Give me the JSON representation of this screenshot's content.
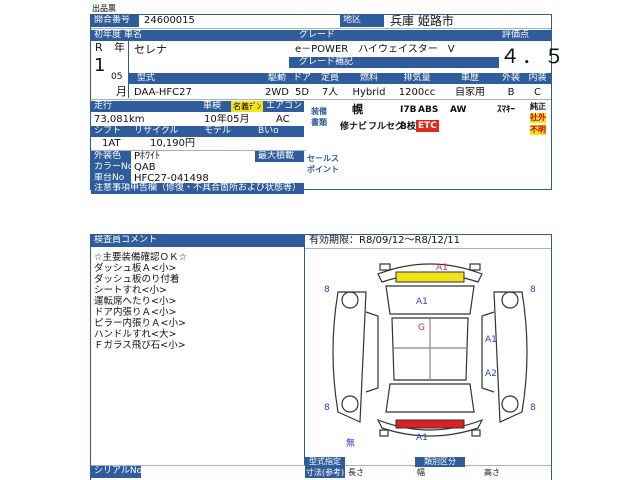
{
  "document_title": "出品票",
  "auction_no": {
    "label": "開合番号",
    "value": "24600015"
  },
  "region": {
    "label": "地区",
    "value": "兵庫 姫路市"
  },
  "first_reg": {
    "label": "初年度",
    "era": "R",
    "year": "1",
    "year_label": "年",
    "month": "05",
    "month_label": "月"
  },
  "car_name": {
    "label": "車名",
    "value": "セレナ"
  },
  "grade": {
    "label": "グレード",
    "value": "e－POWER　ハイウェイスター　V"
  },
  "grade_supplement": {
    "label": "グレード補記",
    "value": ""
  },
  "score": {
    "label": "評価点",
    "value": "４．５"
  },
  "model": {
    "label": "型式",
    "value": "DAA-HFC27"
  },
  "drive": {
    "label": "駆動",
    "value": "2WD"
  },
  "doors": {
    "label": "ドア",
    "value": "5D"
  },
  "seats": {
    "label": "定員",
    "value": "7人"
  },
  "fuel": {
    "label": "燃料",
    "value": "Hybrid"
  },
  "displacement": {
    "label": "排気量",
    "value": "1200cc"
  },
  "usage": {
    "label": "車歴",
    "value": "自家用"
  },
  "exterior": {
    "label": "外装",
    "value": "B"
  },
  "interior": {
    "label": "内装",
    "value": "C"
  },
  "mileage": {
    "label": "走行",
    "value": "73,081km"
  },
  "inspection": {
    "label": "車検",
    "badge": "名義ﾃﾞﾝ",
    "value": "10年05月"
  },
  "aircon": {
    "label": "エアコン",
    "value": "AC"
  },
  "equipment": {
    "label": "装備",
    "label2": "書類"
  },
  "options_row1": [
    "幌",
    "I7B",
    "ABS",
    "AW",
    "ｽﾏｷｰ"
  ],
  "options_row2": [
    "修ナビ",
    "フルセグ",
    "B枝",
    "ETC"
  ],
  "right_flags": [
    "純正",
    "社外",
    "不明"
  ],
  "shift": {
    "label": "シフト",
    "value": "1AT"
  },
  "recycle": {
    "label": "リサイクル",
    "value": "10,190円"
  },
  "model_code": {
    "label": "モデル",
    "value": ""
  },
  "bno": {
    "label": "Bいo",
    "value": ""
  },
  "max_load": {
    "label": "最大積載",
    "value": ""
  },
  "sales_point": {
    "label": "セールス",
    "label2": "ポイント"
  },
  "ext_color": {
    "label": "外装色",
    "value": "Pﾎﾜｲﾄ"
  },
  "color_no": {
    "label": "カラーNo",
    "value": "QAB"
  },
  "chassis_no": {
    "label": "車台No",
    "value": "HFC27-041498"
  },
  "notes": {
    "label": "注意事項申告欄（修復・不具合箇所および状態等）",
    "value": ""
  },
  "inspector_comment": {
    "label": "検査員コメント",
    "lines": [
      "☆主要装備確認ＯＫ☆",
      "ダッシュ板Ａ<小>",
      "ダッシュ板のり付着",
      "シートすれ<小>",
      "運転席へたり<小>",
      "ドア内張りＡ<小>",
      "ピラー内張りＡ<小>",
      "ハンドルすれ<大>",
      "Ｆガラス飛び石<小>"
    ]
  },
  "validity": {
    "label": "有効期限：",
    "value": "R8/09/12～R8/12/11"
  },
  "damage_marks": [
    "A1",
    "8",
    "8",
    "A1",
    "G",
    "A1",
    "A2",
    "8",
    "8",
    "A1",
    "無"
  ],
  "serial": {
    "label": "シリアルNo",
    "value": ""
  },
  "model_designation": {
    "label": "型式指定",
    "label2": "寸法(参考)"
  },
  "classification": {
    "label": "類別区分"
  },
  "dimensions": {
    "length": "長さ",
    "width": "幅",
    "height": "高さ"
  },
  "colors": {
    "header": "#2f5c9a",
    "label_blue": "#2f5c9a",
    "flag_red": "#e0281c",
    "mark_blue": "#2b3fd1",
    "mark_red": "#cc2a6c",
    "yellow_part": "#f2e21b",
    "red_part": "#e02020"
  }
}
